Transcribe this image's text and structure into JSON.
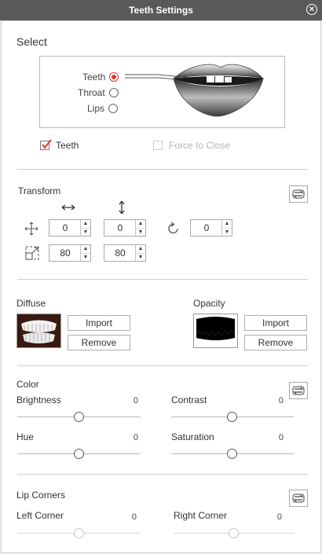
{
  "window": {
    "title": "Teeth Settings"
  },
  "select": {
    "heading": "Select",
    "options": [
      {
        "label": "Teeth",
        "selected": true
      },
      {
        "label": "Throat",
        "selected": false
      },
      {
        "label": "Lips",
        "selected": false
      }
    ],
    "teeth_checkbox": {
      "label": "Teeth",
      "checked": true
    },
    "force_close_checkbox": {
      "label": "Force to Close",
      "checked": false,
      "enabled": false
    }
  },
  "transform": {
    "heading": "Transform",
    "move_x": "0",
    "move_y": "0",
    "rotate": "0",
    "scale_x": "80",
    "scale_y": "80"
  },
  "diffuse": {
    "heading": "Diffuse",
    "import_label": "Import",
    "remove_label": "Remove"
  },
  "opacity": {
    "heading": "Opacity",
    "import_label": "Import",
    "remove_label": "Remove"
  },
  "color": {
    "heading": "Color",
    "brightness": {
      "label": "Brightness",
      "value": "0"
    },
    "contrast": {
      "label": "Contrast",
      "value": "0"
    },
    "hue": {
      "label": "Hue",
      "value": "0"
    },
    "saturation": {
      "label": "Saturation",
      "value": "0"
    }
  },
  "lip_corners": {
    "heading": "Lip Corners",
    "left": {
      "label": "Left Corner",
      "value": "0"
    },
    "right": {
      "label": "Right Corner",
      "value": "0"
    }
  },
  "colors": {
    "titlebar": "#5a5a5a",
    "radio_selected": "#e23b2e",
    "checkmark": "#e23b2e"
  }
}
